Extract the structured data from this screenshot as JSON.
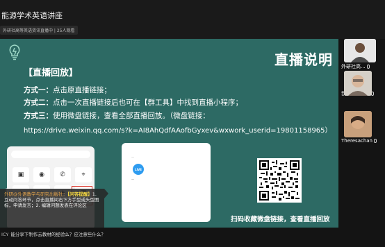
{
  "header": {
    "title": "能源学术英语讲座",
    "channel": "外研社高等英语资讯直播中",
    "viewers": "25人观看"
  },
  "slide": {
    "title": "直播说明",
    "heading": "【直播回放】",
    "method1_label": "方式一：",
    "method1_text": "点击原直播链接；",
    "method2_label": "方式二：",
    "method2_text": "点击一次直播链接后也可在【群工具】中找到直播小程序；",
    "method3_label": "方式三：",
    "method3_text": "使用微盘链接，查看全部直播回放。（微盘链接：",
    "url": "https://drive.weixin.qq.com/s?k=AI8AhQdfAAofbGyxev&wxwork_userid=19801158965）",
    "qr_caption": "扫码收藏微盘链接，查看直播回放",
    "dialog_live": "LIVE"
  },
  "chat": {
    "in_comment": "在评论区",
    "tooltip_sender": "外研@外语教学与研究出版社：",
    "tooltip_tag": "【问答提醒】",
    "tooltip_text": "1. 互动问答环节，点击直播间右下方手型或头型图标，申请发言；2. 编辑问题发表在评论区",
    "comment_name": "ICY",
    "comment_text": "能分享下制作云教材的经验么？应注意些什么？"
  },
  "participants": [
    {
      "name": "外研社高..."
    },
    {
      "name": "我"
    },
    {
      "name": "Theresachan"
    }
  ],
  "icons": [
    "lightbulb-icon",
    "qr-code-icon",
    "mic-icon",
    "live-icon"
  ],
  "colors": {
    "slide_bg": "#2d6a64",
    "tooltip_sender": "#e7a64c",
    "tooltip_tag": "#f5d742",
    "live_badge": "#2e9cf0",
    "highlight_box": "#d93025"
  }
}
